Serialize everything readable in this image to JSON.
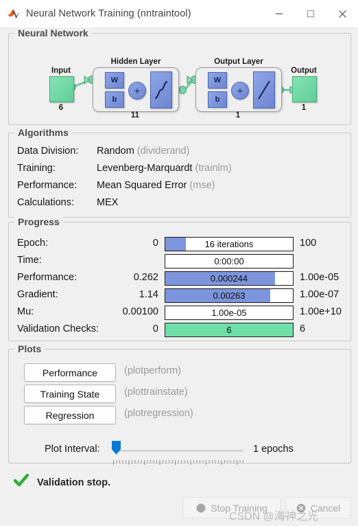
{
  "window": {
    "title": "Neural Network Training (nntraintool)",
    "icon": "matlab-membrane-icon",
    "minimize": "—",
    "maximize": "▫",
    "close": "✕"
  },
  "neural_network": {
    "panel_title": "Neural Network",
    "input": {
      "label": "Input",
      "count": "6"
    },
    "hidden_layer": {
      "label": "Hidden Layer",
      "count": "11",
      "weight": "W",
      "bias": "b",
      "sum": "+",
      "activation": "sigmoid"
    },
    "output_layer": {
      "label": "Output Layer",
      "count": "1",
      "weight": "W",
      "bias": "b",
      "sum": "+",
      "activation": "linear"
    },
    "output": {
      "label": "Output",
      "count": "1"
    }
  },
  "algorithms": {
    "panel_title": "Algorithms",
    "rows": [
      {
        "key": "Data Division:",
        "value": "Random",
        "fn": "(dividerand)"
      },
      {
        "key": "Training:",
        "value": "Levenberg-Marquardt",
        "fn": "(trainlm)"
      },
      {
        "key": "Performance:",
        "value": "Mean Squared Error",
        "fn": "(mse)"
      },
      {
        "key": "Calculations:",
        "value": "MEX",
        "fn": ""
      }
    ]
  },
  "progress": {
    "panel_title": "Progress",
    "rows": [
      {
        "label": "Epoch:",
        "left": "0",
        "bar_text": "16 iterations",
        "fill_pct": 16,
        "color": "blue",
        "right": "100"
      },
      {
        "label": "Time:",
        "left": "",
        "bar_text": "0:00:00",
        "fill_pct": 0,
        "color": "blue",
        "right": ""
      },
      {
        "label": "Performance:",
        "left": "0.262",
        "bar_text": "0.000244",
        "fill_pct": 86,
        "color": "blue",
        "right": "1.00e-05"
      },
      {
        "label": "Gradient:",
        "left": "1.14",
        "bar_text": "0.00263",
        "fill_pct": 82,
        "color": "blue",
        "right": "1.00e-07"
      },
      {
        "label": "Mu:",
        "left": "0.00100",
        "bar_text": "1.00e-05",
        "fill_pct": 0,
        "color": "blue",
        "right": "1.00e+10"
      },
      {
        "label": "Validation Checks:",
        "left": "0",
        "bar_text": "6",
        "fill_pct": 100,
        "color": "green",
        "right": "6"
      }
    ]
  },
  "plots": {
    "panel_title": "Plots",
    "buttons": [
      {
        "label": "Performance",
        "fn": "(plotperform)"
      },
      {
        "label": "Training State",
        "fn": "(plottrainstate)"
      },
      {
        "label": "Regression",
        "fn": "(plotregression)"
      }
    ],
    "interval": {
      "label": "Plot Interval:",
      "value": "1 epochs"
    }
  },
  "status": {
    "icon": "green-check-icon",
    "text": "Validation stop."
  },
  "footer": {
    "stop_training": "Stop Training",
    "stop_icon": "stop-sign-icon",
    "cancel": "Cancel",
    "cancel_icon": "cancel-circle-icon"
  },
  "watermark": {
    "prefix": "CSDN @",
    "name": "海神之光"
  },
  "colors": {
    "progress_blue": "#7d95dd",
    "progress_green": "#6fdfa8",
    "node_green": "#5fcf96",
    "node_blue": "#6d86d0",
    "slider_blue": "#0b7ad5",
    "check_green": "#2eaf34"
  }
}
